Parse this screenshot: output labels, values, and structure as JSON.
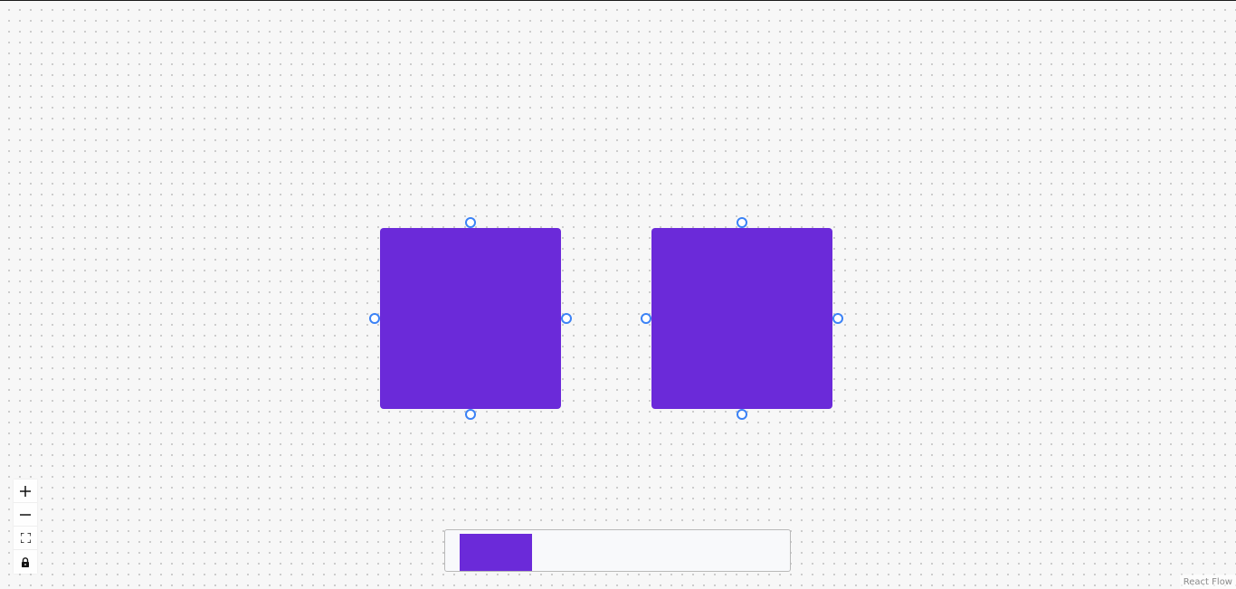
{
  "flow": {
    "nodes": [
      {
        "id": "node-1",
        "color": "#6b2ad9"
      },
      {
        "id": "node-2",
        "color": "#6b2ad9"
      }
    ],
    "handle_color": "#3b82f6"
  },
  "controls": {
    "zoom_in_icon": "plus-icon",
    "zoom_out_icon": "minus-icon",
    "fit_view_icon": "fit-view-icon",
    "lock_icon": "lock-icon"
  },
  "minimap": {
    "node_color": "#6b2ad9"
  },
  "attribution": {
    "label": "React Flow"
  }
}
